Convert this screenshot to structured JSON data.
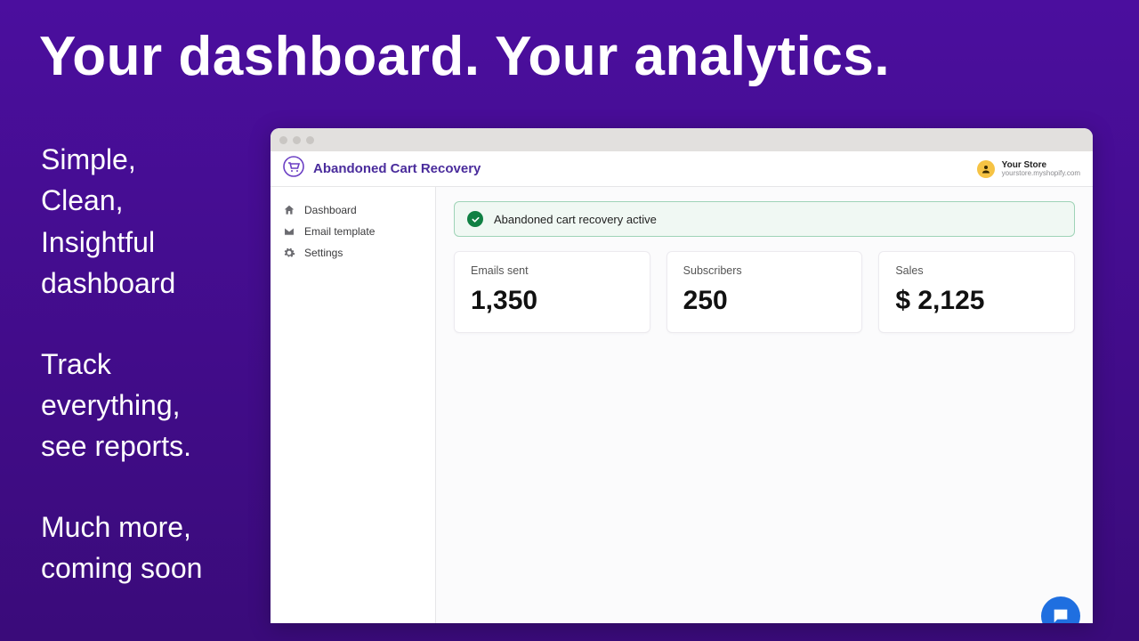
{
  "hero": {
    "title": "Your dashboard. Your analytics."
  },
  "blurbs": {
    "group1": "Simple,\nClean,\nInsightful\ndashboard",
    "group2": "Track\neverything,\nsee reports.",
    "group3": "Much more,\ncoming soon"
  },
  "app": {
    "brand_title": "Abandoned Cart Recovery",
    "store_name": "Your Store",
    "store_url": "yourstore.myshopify.com",
    "sidebar": {
      "items": [
        {
          "label": "Dashboard",
          "icon": "home-icon"
        },
        {
          "label": "Email template",
          "icon": "mail-icon"
        },
        {
          "label": "Settings",
          "icon": "gear-icon"
        }
      ]
    },
    "banner": {
      "text": "Abandoned cart recovery active"
    },
    "stats": [
      {
        "label": "Emails sent",
        "value": "1,350"
      },
      {
        "label": "Subscribers",
        "value": "250"
      },
      {
        "label": "Sales",
        "value": "$ 2,125"
      }
    ]
  },
  "colors": {
    "brand_purple": "#4a2c9c",
    "success_green": "#108043",
    "chat_blue": "#1f6fe0"
  }
}
